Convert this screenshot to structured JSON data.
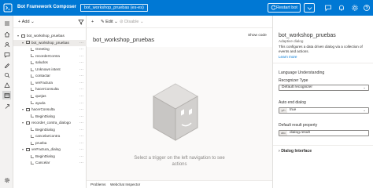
{
  "titlebar": {
    "app_title": "Bot Framework Composer",
    "bot_name": "bot_workshop_pruebas (es-es)",
    "restart_label": "Restart bot",
    "brand_color": "#0078d4"
  },
  "navrail": {
    "icons": [
      "menu-icon",
      "home-icon",
      "design-icon",
      "bot-responses-icon",
      "user-input-icon",
      "language-understanding-icon",
      "qna-icon",
      "notifications-icon",
      "publish-icon",
      "settings-icon"
    ]
  },
  "tree": {
    "add_label": "Add",
    "items": [
      {
        "label": "bot_workshop_pruebas",
        "level": 0,
        "kind": "root"
      },
      {
        "label": "bot_workshop_pruebas",
        "level": 1,
        "kind": "dialog",
        "selected": true
      },
      {
        "label": "Greeting",
        "level": 2,
        "kind": "trigger"
      },
      {
        "label": "recorderContra",
        "level": 2,
        "kind": "trigger"
      },
      {
        "label": "saludos",
        "level": 2,
        "kind": "trigger"
      },
      {
        "label": "Unknown intent",
        "level": 2,
        "kind": "trigger"
      },
      {
        "label": "contactar",
        "level": 2,
        "kind": "trigger"
      },
      {
        "label": "verFactura",
        "level": 2,
        "kind": "trigger"
      },
      {
        "label": "hacerConsulta",
        "level": 2,
        "kind": "trigger"
      },
      {
        "label": "quejas",
        "level": 2,
        "kind": "trigger"
      },
      {
        "label": "ayuda",
        "level": 2,
        "kind": "trigger"
      },
      {
        "label": "hacerConsulta",
        "level": 1,
        "kind": "dialog"
      },
      {
        "label": "BeginDialog",
        "level": 2,
        "kind": "trigger"
      },
      {
        "label": "recorder_contra_dialogo",
        "level": 1,
        "kind": "dialog"
      },
      {
        "label": "BeginDialog",
        "level": 2,
        "kind": "trigger"
      },
      {
        "label": "cancelarContra",
        "level": 2,
        "kind": "trigger"
      },
      {
        "label": "prueba",
        "level": 2,
        "kind": "trigger"
      },
      {
        "label": "verFactura_dialog",
        "level": 1,
        "kind": "dialog"
      },
      {
        "label": "BeginDialog",
        "level": 2,
        "kind": "trigger"
      },
      {
        "label": "Cancelar",
        "level": 2,
        "kind": "trigger"
      }
    ]
  },
  "canvas": {
    "edit_label": "Edit",
    "disable_label": "Disable",
    "dialog_title": "bot_workshop_pruebas",
    "show_code_label": "Show code",
    "empty_message": "Select a trigger on the left navigation to see actions",
    "bottom_tabs": [
      "Problems",
      "Webchat Inspector"
    ]
  },
  "properties": {
    "title": "bot_workshop_pruebas",
    "subtitle": "Adaptive dialog",
    "description": "This configures a data driven dialog via a collection of events and actions.",
    "learn_more": "Learn more",
    "lu_section": "Language Understanding",
    "recognizer_label": "Recognizer Type",
    "recognizer_value": "Default recognizer",
    "auto_end_label": "Auto end dialog",
    "auto_end_tag": "y/n",
    "auto_end_value": "true",
    "default_result_label": "Default result property",
    "default_result_tag": "abc",
    "default_result_value": "dialog.result",
    "dialog_interface_label": "Dialog Interface"
  }
}
